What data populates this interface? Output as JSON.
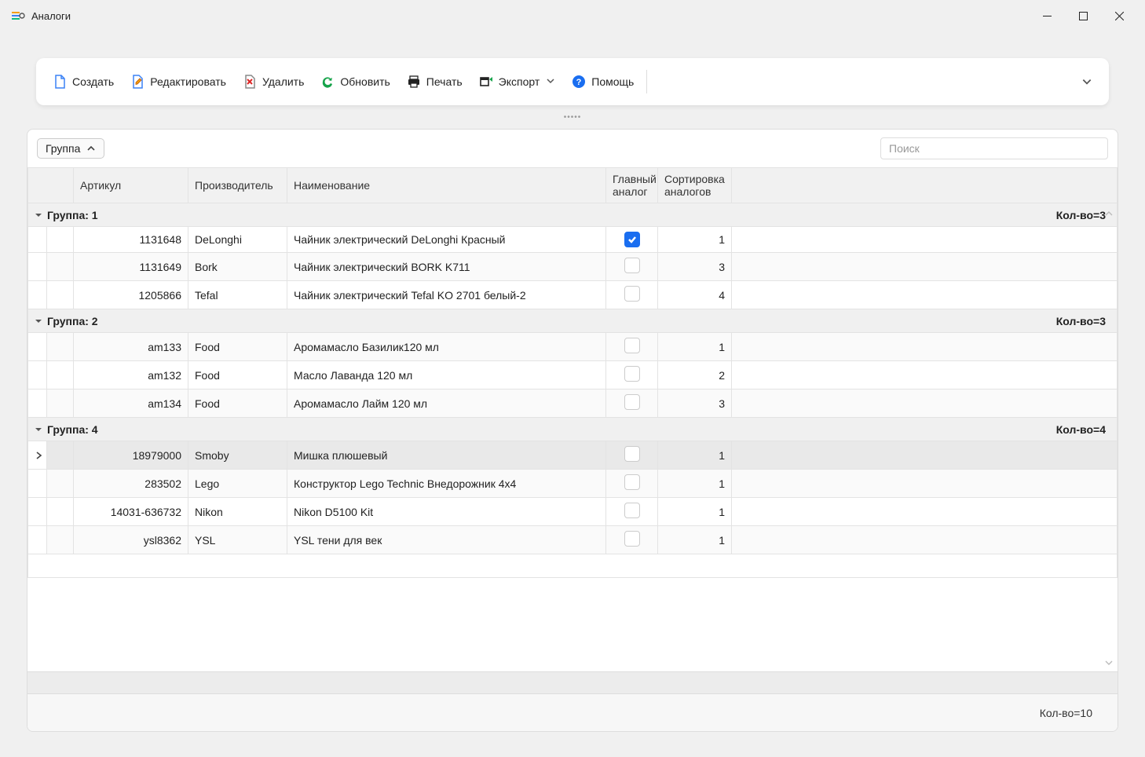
{
  "window": {
    "title": "Аналоги"
  },
  "toolbar": {
    "create": "Создать",
    "edit": "Редактировать",
    "delete": "Удалить",
    "refresh": "Обновить",
    "print": "Печать",
    "export": "Экспорт",
    "help": "Помощь"
  },
  "group_chip": {
    "label": "Группа"
  },
  "search": {
    "placeholder": "Поиск"
  },
  "columns": {
    "article": "Артикул",
    "manufacturer": "Производитель",
    "name": "Наименование",
    "main_analog": "Главный аналог",
    "sort": "Сортировка аналогов"
  },
  "groups": [
    {
      "label": "Группа: 1",
      "count_label": "Кол-во=3",
      "rows": [
        {
          "article": "1131648",
          "manufacturer": "DeLonghi",
          "name": "Чайник электрический DeLonghi Красный",
          "main": true,
          "sort": "1",
          "alt": false
        },
        {
          "article": "1131649",
          "manufacturer": "Bork",
          "name": "Чайник электрический BORK K711",
          "main": false,
          "sort": "3",
          "alt": true
        },
        {
          "article": "1205866",
          "manufacturer": "Tefal",
          "name": "Чайник электрический Tefal KO 2701 белый-2",
          "main": false,
          "sort": "4",
          "alt": false
        }
      ]
    },
    {
      "label": "Группа: 2",
      "count_label": "Кол-во=3",
      "rows": [
        {
          "article": "am133",
          "manufacturer": "Food",
          "name": "Аромамасло Базилик120 мл",
          "main": false,
          "sort": "1",
          "alt": true
        },
        {
          "article": "am132",
          "manufacturer": "Food",
          "name": "Масло Лаванда 120 мл",
          "main": false,
          "sort": "2",
          "alt": false
        },
        {
          "article": "am134",
          "manufacturer": "Food",
          "name": "Аромамасло Лайм 120 мл",
          "main": false,
          "sort": "3",
          "alt": true
        }
      ]
    },
    {
      "label": "Группа: 4",
      "count_label": "Кол-во=4",
      "rows": [
        {
          "article": "18979000",
          "manufacturer": "Smoby",
          "name": "Мишка плюшевый",
          "main": false,
          "sort": "1",
          "alt": true,
          "selected": true
        },
        {
          "article": "283502",
          "manufacturer": "Lego",
          "name": "Конструктор Lego Technic Внедорожник 4x4",
          "main": false,
          "sort": "1",
          "alt": true
        },
        {
          "article": "14031-636732",
          "manufacturer": "Nikon",
          "name": "Nikon D5100 Kit",
          "main": false,
          "sort": "1",
          "alt": false
        },
        {
          "article": "ysl8362",
          "manufacturer": "YSL",
          "name": "YSL тени для век",
          "main": false,
          "sort": "1",
          "alt": true
        }
      ]
    }
  ],
  "footer": {
    "total_label": "Кол-во=10"
  }
}
